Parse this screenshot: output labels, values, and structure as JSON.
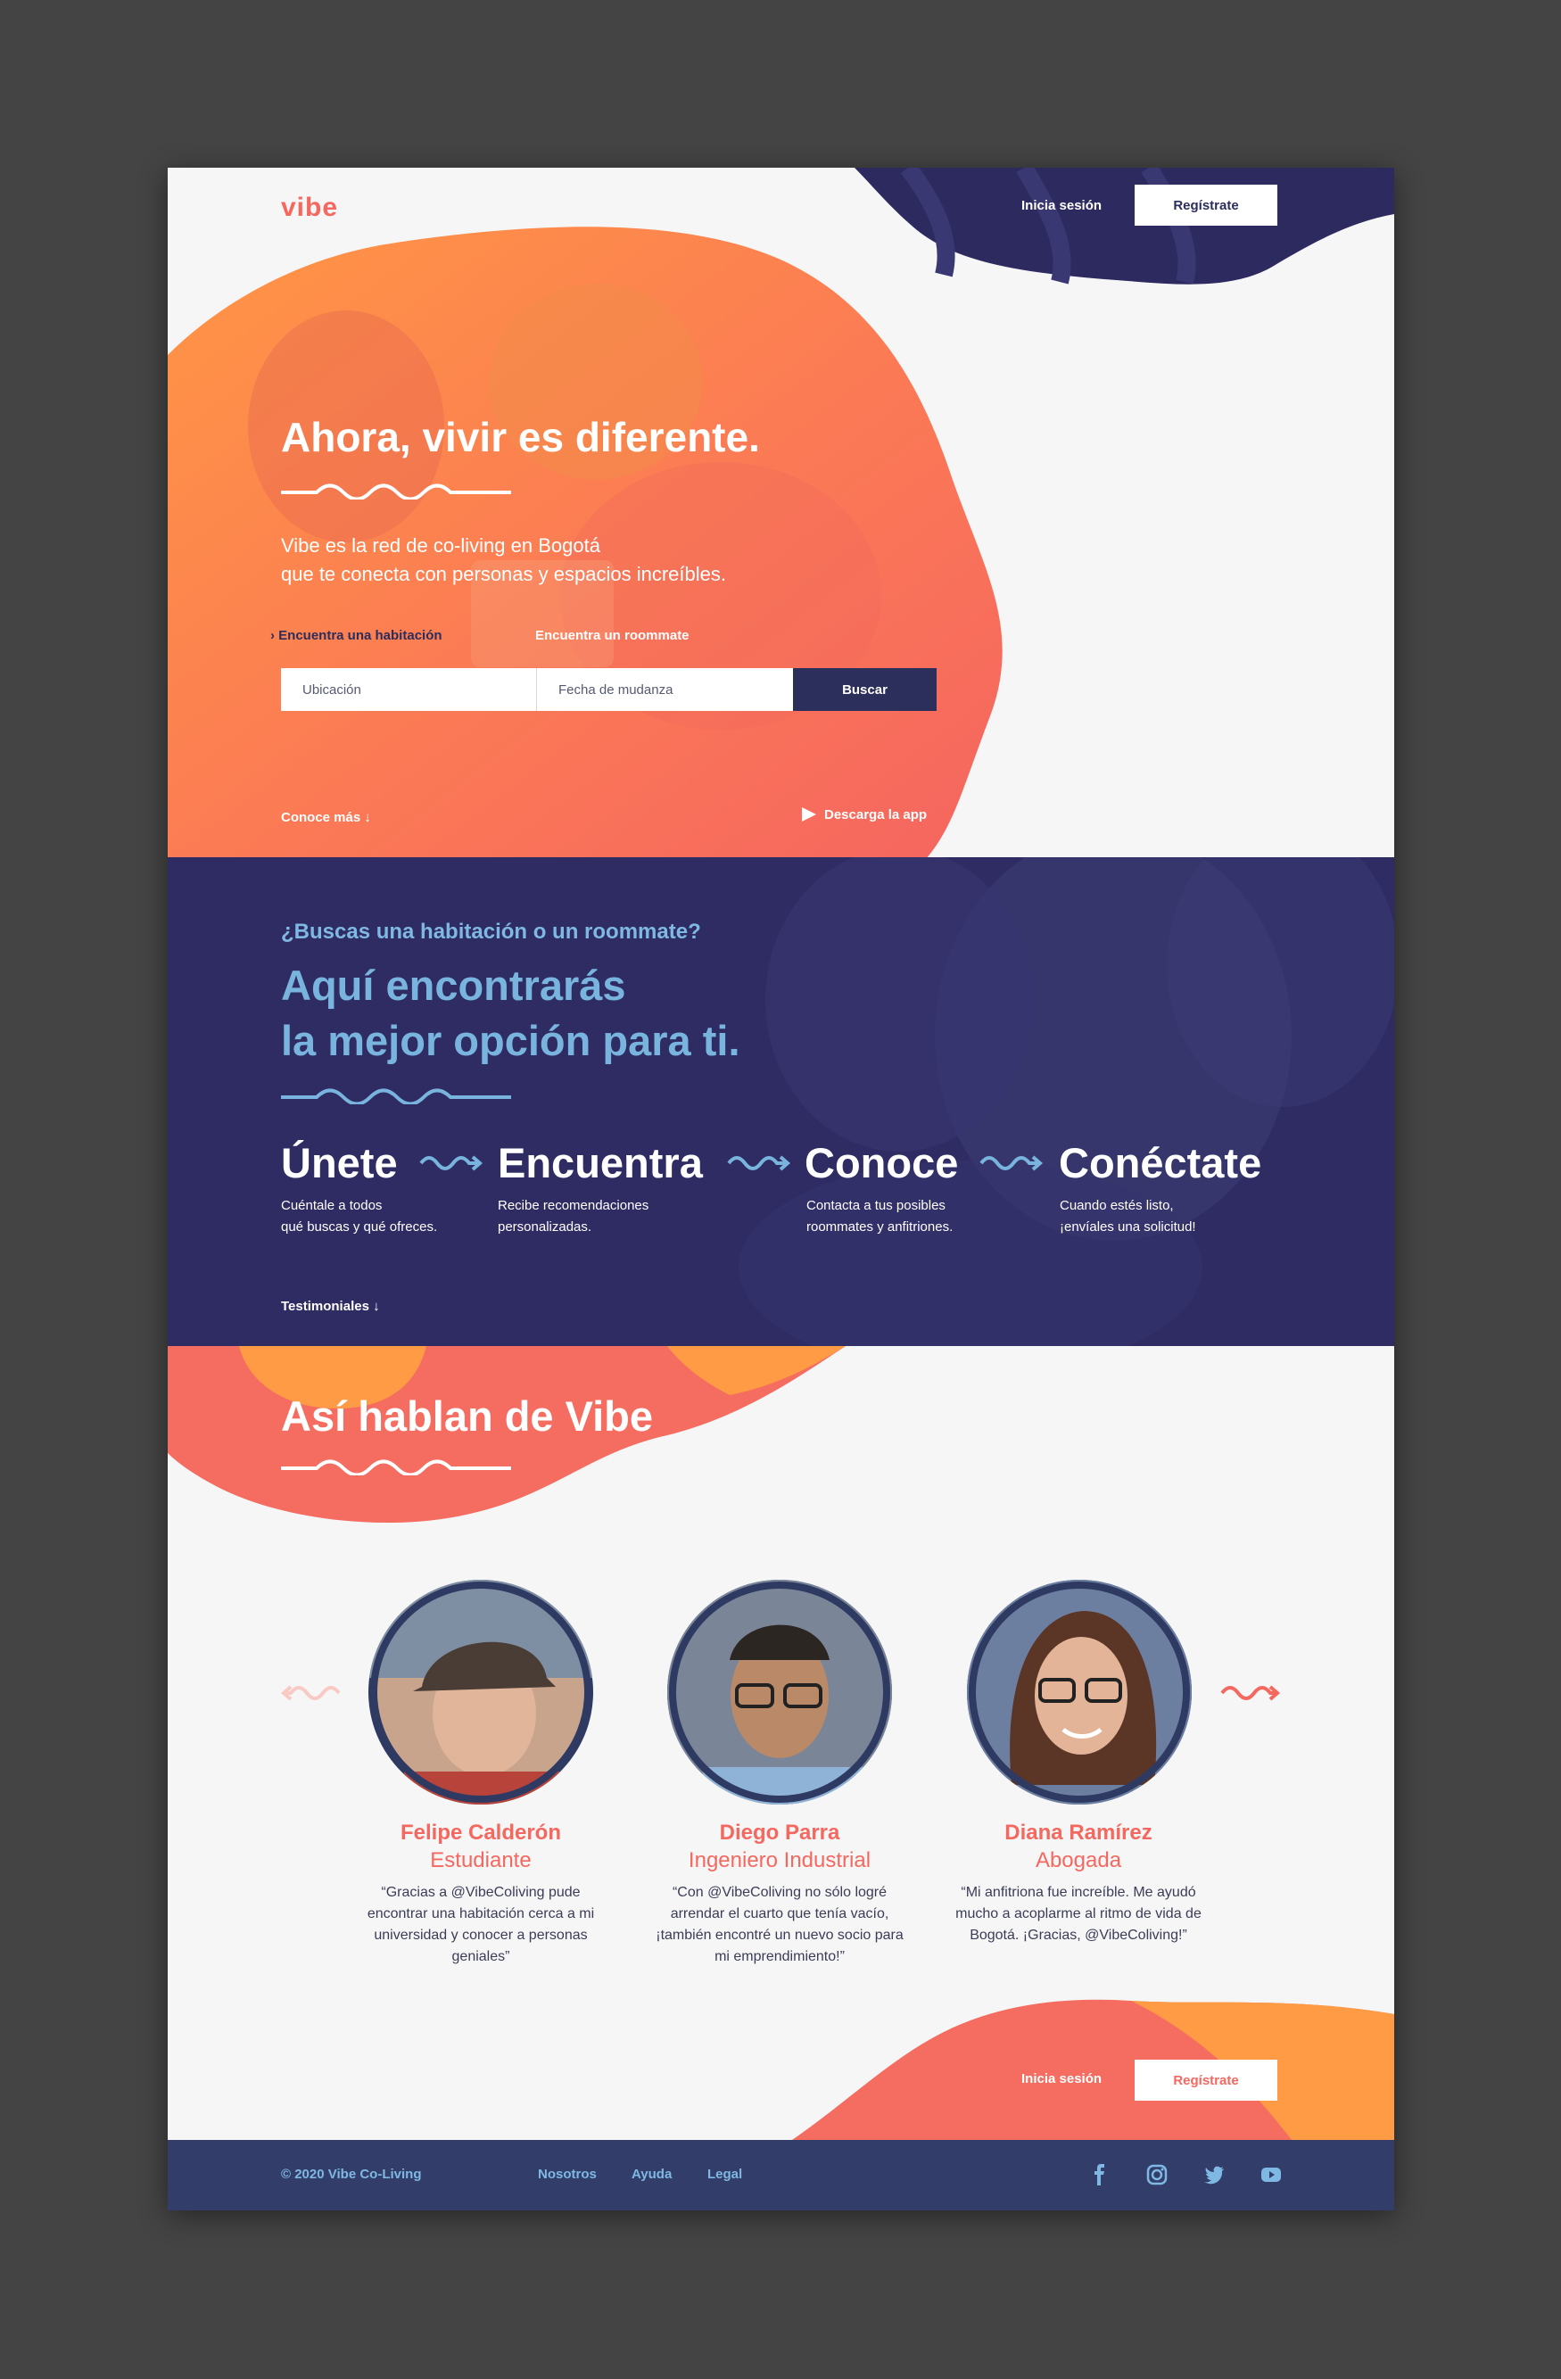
{
  "header": {
    "logo": "vibe",
    "login": "Inicia sesión",
    "register": "Regístrate"
  },
  "hero": {
    "title": "Ahora, vivir es diferente.",
    "subtitle_line1": "Vibe es la red de co-living en Bogotá",
    "subtitle_line2": "que te conecta con personas y espacios increíbles.",
    "tabs": [
      {
        "label": "› Encuentra una habitación",
        "active": true
      },
      {
        "label": "Encuentra un roommate",
        "active": false
      }
    ],
    "search": {
      "location": "Ubicación",
      "move_date": "Fecha de mudanza",
      "button": "Buscar"
    },
    "learn_more": "Conoce más ↓",
    "download_app": "Descarga la app"
  },
  "how": {
    "question": "¿Buscas una habitación o un roommate?",
    "headline_line1": "Aquí encontrarás",
    "headline_line2": "la mejor opción para ti.",
    "steps": [
      {
        "title": "Únete",
        "desc_line1": "Cuéntale a todos",
        "desc_line2": "qué buscas y qué ofreces."
      },
      {
        "title": "Encuentra",
        "desc_line1": "Recibe recomendaciones",
        "desc_line2": "personalizadas."
      },
      {
        "title": "Conoce",
        "desc_line1": "Contacta a tus posibles",
        "desc_line2": "roommates y anfitriones."
      },
      {
        "title": "Conéctate",
        "desc_line1": "Cuando estés listo,",
        "desc_line2": "¡envíales una solicitud!"
      }
    ],
    "testimonials_link": "Testimoniales ↓"
  },
  "testimonials": {
    "title": "Así hablan de Vibe",
    "people": [
      {
        "name": "Felipe Calderón",
        "role": "Estudiante",
        "quote": "“Gracias a @VibeColiving pude encontrar una habitación cerca a mi universidad y conocer a personas geniales”"
      },
      {
        "name": "Diego Parra",
        "role": "Ingeniero Industrial",
        "quote": "“Con @VibeColiving no sólo logré arrendar el cuarto que tenía vacío, ¡también encontré un nuevo socio para mi emprendimiento!”"
      },
      {
        "name": "Diana Ramírez",
        "role": "Abogada",
        "quote": "“Mi anfitriona fue increíble. Me ayudó mucho a acoplarme al ritmo de vida de Bogotá. ¡Gracias, @VibeColiving!”"
      }
    ]
  },
  "cta": {
    "login": "Inicia sesión",
    "register": "Regístrate"
  },
  "footer": {
    "copyright": "© 2020 Vibe Co-Living",
    "links": [
      "Nosotros",
      "Ayuda",
      "Legal"
    ],
    "social": [
      "facebook-icon",
      "instagram-icon",
      "twitter-icon",
      "youtube-icon"
    ]
  },
  "colors": {
    "coral": "#f4685f",
    "orange": "#ff9a45",
    "navy": "#2e2c62",
    "light_blue": "#79b4de",
    "footer": "#323d6a"
  }
}
